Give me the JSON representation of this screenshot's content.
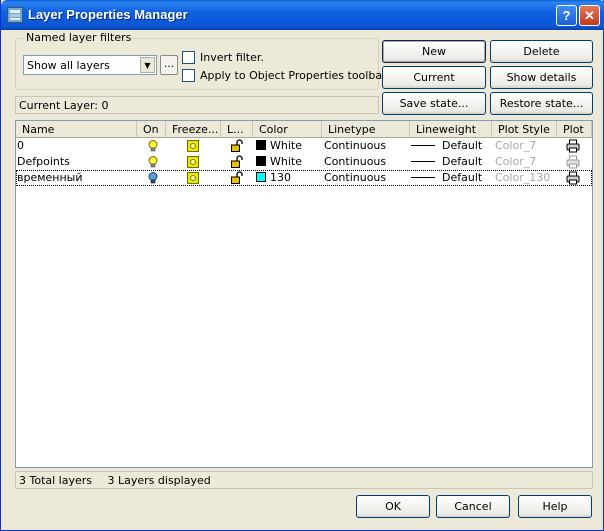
{
  "window": {
    "title": "Layer Properties Manager"
  },
  "title_buttons": {
    "help": "?",
    "close": "✕"
  },
  "filters": {
    "group_label": "Named layer filters",
    "selected": "Show all layers",
    "dots_label": "...",
    "invert_label": "Invert filter.",
    "apply_label": "Apply to Object Properties toolbar."
  },
  "buttons": {
    "new": "New",
    "delete": "Delete",
    "current": "Current",
    "show_details": "Show details",
    "save_state": "Save state...",
    "restore_state": "Restore state...",
    "ok": "OK",
    "cancel": "Cancel",
    "help": "Help"
  },
  "current_layer": "Current Layer:   0",
  "columns": [
    "Name",
    "On",
    "Freeze...",
    "L...",
    "Color",
    "Linetype",
    "Lineweight",
    "Plot Style",
    "Plot"
  ],
  "layers": [
    {
      "name": "0",
      "on": "lightbulb-on",
      "freeze": "sun-thawed",
      "lock": "padlock-unlocked",
      "color_name": "White",
      "color_hex": "#000000",
      "linetype": "Continuous",
      "lineweight": "Default",
      "plot_style": "Color_7",
      "plot": "printer"
    },
    {
      "name": "Defpoints",
      "on": "lightbulb-on",
      "freeze": "sun-thawed",
      "lock": "padlock-unlocked",
      "color_name": "White",
      "color_hex": "#000000",
      "linetype": "Continuous",
      "lineweight": "Default",
      "plot_style": "Color_7",
      "plot": "printer-disabled"
    },
    {
      "name": "временный",
      "on": "lightbulb-on",
      "freeze": "sun-thawed",
      "lock": "padlock-unlocked",
      "color_name": "130",
      "color_hex": "#00ffff",
      "linetype": "Continuous",
      "lineweight": "Default",
      "plot_style": "Color_130",
      "plot": "printer"
    }
  ],
  "status": {
    "total": "3 Total layers",
    "displayed": "3 Layers displayed"
  },
  "colors": {
    "titlebar": "#0b56d3",
    "dialog": "#ece9d8",
    "close": "#c0391c"
  }
}
